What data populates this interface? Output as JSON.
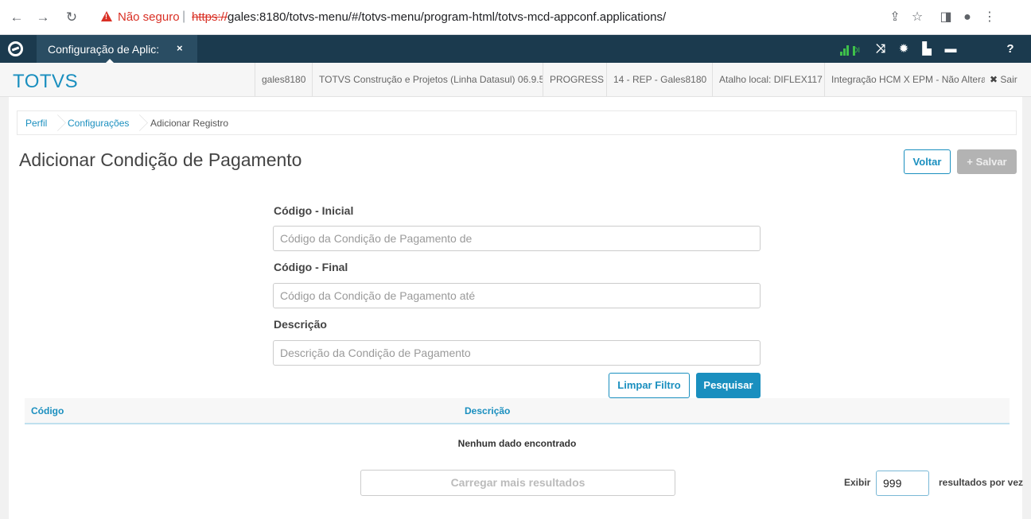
{
  "browser": {
    "not_secure": "Não seguro",
    "url_scheme": "https://",
    "url_rest": "gales:8180/totvs-menu/#/totvs-menu/program-html/totvs-mcd-appconf.applications/"
  },
  "appbar": {
    "tab_title": "Configuração de Aplic:",
    "tab_close": "×",
    "signal_text": "DI"
  },
  "infobar": {
    "brand": "TOTVS",
    "items": [
      "gales8180",
      "TOTVS Construção e Projetos (Linha Datasul) 06.9.5...",
      "PROGRESS",
      "14 - REP - Gales8180",
      "Atalho local: DIFLEX117",
      "Integração HCM X EPM - Não Alterar"
    ],
    "exit_label": "Sair"
  },
  "breadcrumb": {
    "items": [
      "Perfil",
      "Configurações",
      "Adicionar Registro"
    ]
  },
  "page": {
    "title": "Adicionar Condição de Pagamento",
    "back_label": "Voltar",
    "save_label": "+ Salvar"
  },
  "filters": {
    "code_start_label": "Código - Inicial",
    "code_start_placeholder": "Código da Condição de Pagamento de",
    "code_end_label": "Código - Final",
    "code_end_placeholder": "Código da Condição de Pagamento até",
    "desc_label": "Descrição",
    "desc_placeholder": "Descrição da Condição de Pagamento",
    "clear_label": "Limpar Filtro",
    "search_label": "Pesquisar"
  },
  "grid": {
    "columns": [
      "Código",
      "Descrição"
    ],
    "empty_text": "Nenhum dado encontrado"
  },
  "footer": {
    "load_more": "Carregar mais resultados",
    "show_label": "Exibir",
    "show_value": "999",
    "per_page": "resultados por vez"
  }
}
